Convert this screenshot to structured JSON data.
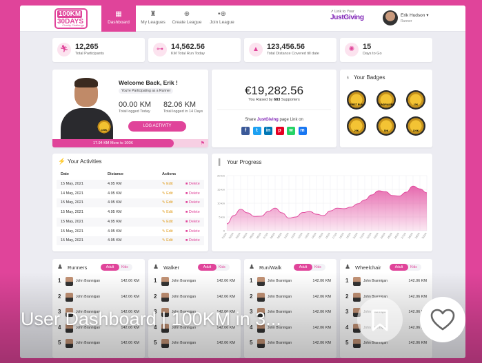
{
  "nav": {
    "logo_line1": "100KM",
    "logo_line2": "30DAYS",
    "logo_sub": "Charity Challenge",
    "items": [
      {
        "label": "Dashboard",
        "icon": "grid-icon"
      },
      {
        "label": "My Leagues",
        "icon": "trophy-icon"
      },
      {
        "label": "Create League",
        "icon": "plus-icon"
      },
      {
        "label": "Join League",
        "icon": "join-icon"
      }
    ],
    "link_label": "Link to Your",
    "link_brand": "JustGiving",
    "user_name": "Erik Hudson",
    "user_role": "Runner"
  },
  "stats": [
    {
      "value": "12,265",
      "label": "Total Participants",
      "icon": "runner-icon"
    },
    {
      "value": "14,562.56",
      "label": "KM Total Run Today",
      "icon": "road-icon"
    },
    {
      "value": "123,456.56",
      "label": "Total Distance Covered till date",
      "icon": "mountain-icon"
    },
    {
      "value": "15",
      "label": "Days to Go",
      "icon": "calendar-icon"
    }
  ],
  "welcome": {
    "title": "Welcome Back, Erik !",
    "tag": "You're Participating as a Runner",
    "today_value": "00.00 KM",
    "today_label": "Total logged Today",
    "total_value": "82.06 KM",
    "total_label": "Total logged in 14 Days",
    "button": "LOG ACTIVITY",
    "medal": "100K",
    "progress_text": "17.94 KM More to 100K",
    "progress_fraction": 0.8206
  },
  "fundraising": {
    "amount": "€19,282.56",
    "raised_prefix": "You Raised by",
    "supporters": "683",
    "raised_suffix": "Supporters",
    "share_prefix": "Share",
    "share_brand": "JustGiving",
    "share_suffix": "page Link on",
    "socials": [
      {
        "name": "facebook-icon",
        "glyph": "f",
        "color": "#3b5998"
      },
      {
        "name": "twitter-icon",
        "glyph": "t",
        "color": "#1da1f2"
      },
      {
        "name": "linkedin-icon",
        "glyph": "in",
        "color": "#0077b5"
      },
      {
        "name": "pinterest-icon",
        "glyph": "p",
        "color": "#e60023"
      },
      {
        "name": "whatsapp-icon",
        "glyph": "w",
        "color": "#25d366"
      },
      {
        "name": "messenger-icon",
        "glyph": "m",
        "color": "#1877f2"
      }
    ]
  },
  "badges": {
    "title": "Your Badges",
    "items": [
      "FIRST RUN",
      "FUNDRAISER",
      "10K",
      "25K",
      "50K",
      "100K"
    ]
  },
  "activities": {
    "title": "Your Activities",
    "headers": [
      "Date",
      "Distance",
      "Actions"
    ],
    "edit_label": "Edit",
    "delete_label": "Delete",
    "rows": [
      {
        "date": "15 May, 2021",
        "distance": "4.95 KM"
      },
      {
        "date": "14 May, 2021",
        "distance": "4.95 KM"
      },
      {
        "date": "15 May, 2021",
        "distance": "4.95 KM"
      },
      {
        "date": "15 May, 2021",
        "distance": "4.95 KM"
      },
      {
        "date": "15 May, 2021",
        "distance": "4.95 KM"
      },
      {
        "date": "15 May, 2021",
        "distance": "4.95 KM"
      },
      {
        "date": "15 May, 2021",
        "distance": "4.95 KM"
      }
    ]
  },
  "chart_data": {
    "type": "area",
    "title": "Your Progress",
    "ylim": [
      0,
      20
    ],
    "y_ticks": [
      "0",
      "5 km",
      "10 km",
      "15 km",
      "20 km"
    ],
    "x": [
      "01/24",
      "02/24",
      "03/24",
      "04/24",
      "05/24",
      "06/24",
      "07/24",
      "08/24",
      "09/24",
      "10/24",
      "11/24",
      "12/24",
      "13/24",
      "14/24",
      "15/24",
      "16/24",
      "17/24",
      "18/24",
      "19/24",
      "20/24",
      "21/24",
      "22/24",
      "23/24",
      "24/24",
      "25/24",
      "26/24",
      "27/24",
      "28/24",
      "29/24",
      "30/24"
    ],
    "values": [
      2.5,
      5.5,
      7.8,
      6.5,
      5.2,
      5.3,
      7.0,
      8.2,
      6.5,
      4.6,
      5.0,
      6.6,
      7.0,
      6.0,
      5.5,
      7.2,
      8.2,
      8.0,
      8.6,
      9.8,
      11.2,
      13.0,
      14.5,
      14.2,
      12.8,
      12.6,
      14.0,
      16.2,
      15.2,
      13.8
    ],
    "grid": true,
    "color": "#e0449a"
  },
  "leaderboards": [
    {
      "title": "Runners",
      "icon": "runners-icon"
    },
    {
      "title": "Walker",
      "icon": "walker-icon"
    },
    {
      "title": "Run/Walk",
      "icon": "runwalk-icon"
    },
    {
      "title": "Wheelchair",
      "icon": "wheelchair-icon"
    }
  ],
  "leaderboard_common": {
    "adult": "Adult",
    "kids": "Kids",
    "rows": [
      {
        "rank": "1",
        "name": "John Brannigan",
        "km": "142.06 KM"
      },
      {
        "rank": "2",
        "name": "John Brannigan",
        "km": "142.06 KM"
      },
      {
        "rank": "3",
        "name": "John Brannigan",
        "km": "142.06 KM"
      },
      {
        "rank": "4",
        "name": "John Brannigan",
        "km": "142.06 KM"
      },
      {
        "rank": "5",
        "name": "John Brannigan",
        "km": "142.06 KM"
      }
    ]
  },
  "overlay": {
    "caption": "User Dashboard | 100KM in 3..."
  }
}
